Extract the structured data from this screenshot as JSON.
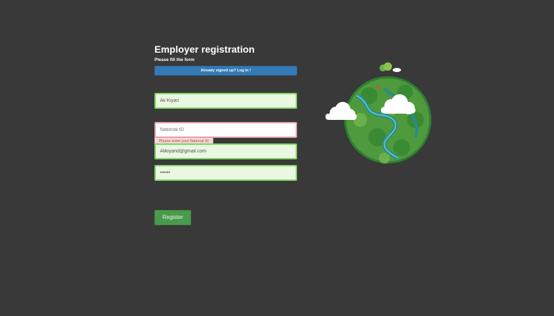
{
  "form": {
    "title": "Employer registration",
    "subtitle": "Please fill the form",
    "login_label": "Already signed up? Log in !",
    "fields": {
      "name": {
        "value": "Ali Kiyan",
        "placeholder": ""
      },
      "national_id": {
        "value": "",
        "placeholder": "National ID",
        "error": "Please enter your National ID"
      },
      "email": {
        "value": "Alikiyand@gmail.com",
        "placeholder": ""
      },
      "password": {
        "value": "••••••",
        "placeholder": ""
      }
    },
    "register_label": "Register"
  },
  "illustration": {
    "icon": "globe-illustration"
  },
  "colors": {
    "background": "#393939",
    "primary": "#337ab7",
    "success": "#4a9a4d",
    "valid_field": "#eaf7e1",
    "error": "#f2d7d8"
  }
}
